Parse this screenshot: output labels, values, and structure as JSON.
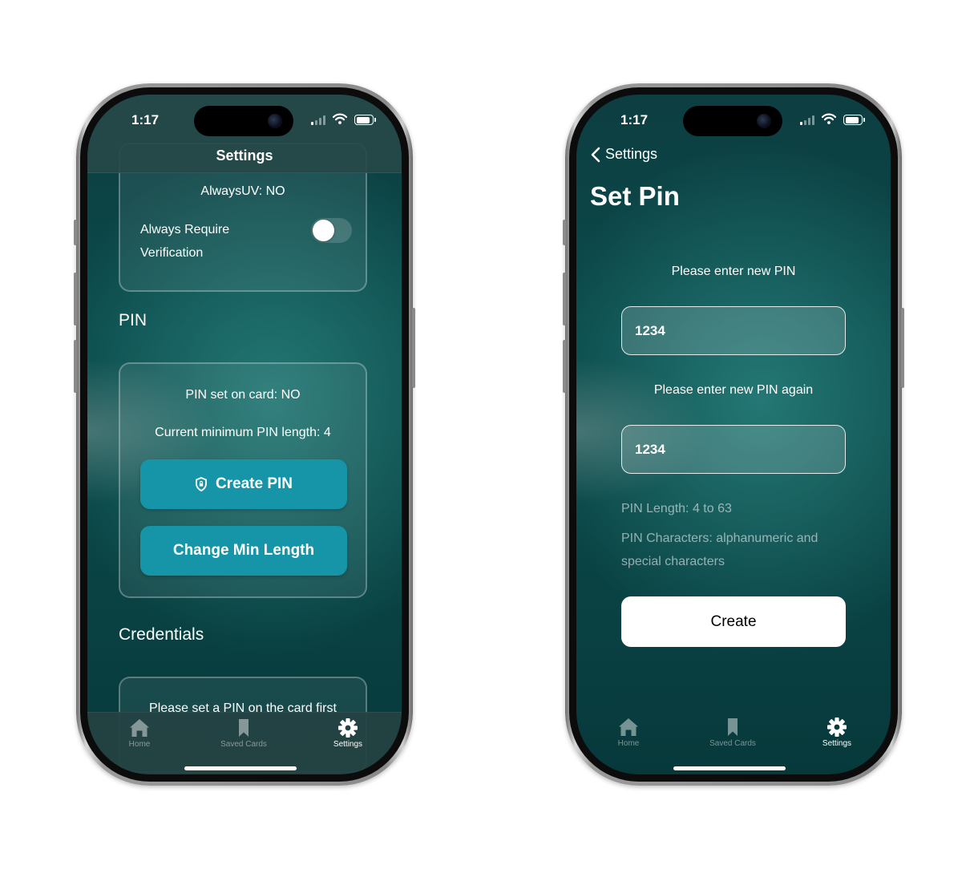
{
  "colors": {
    "screen_teal": "#0b4a4b",
    "button_teal": "#1595a7",
    "white": "#ffffff"
  },
  "status_bar": {
    "time": "1:17"
  },
  "left_screen": {
    "nav_title": "Settings",
    "verification_card": {
      "always_uv": "AlwaysUV: NO",
      "always_require_line1": "Always Require",
      "always_require_line2": "Verification",
      "toggle_on": false
    },
    "pin_section_title": "PIN",
    "pin_card": {
      "pin_set": "PIN set on card: NO",
      "min_length": "Current minimum PIN length: 4",
      "create_button": "Create PIN",
      "change_button": "Change Min Length"
    },
    "credentials_section_title": "Credentials",
    "credentials_card": {
      "message": "Please set a PIN on the card first"
    }
  },
  "right_screen": {
    "back_label": "Settings",
    "title": "Set Pin",
    "prompt_new": "Please enter new PIN",
    "pin_value": "1234",
    "prompt_again": "Please enter new PIN again",
    "pin_again_value": "1234",
    "hint_length": "PIN Length: 4 to 63",
    "hint_chars_line1": "PIN Characters: alphanumeric and",
    "hint_chars_line2": "special characters",
    "create_button": "Create"
  },
  "tab_bar": {
    "items": [
      {
        "label": "Home",
        "icon": "house-icon",
        "active": false
      },
      {
        "label": "Saved Cards",
        "icon": "bookmark-icon",
        "active": false
      },
      {
        "label": "Settings",
        "icon": "gear-icon",
        "active": true
      }
    ]
  }
}
